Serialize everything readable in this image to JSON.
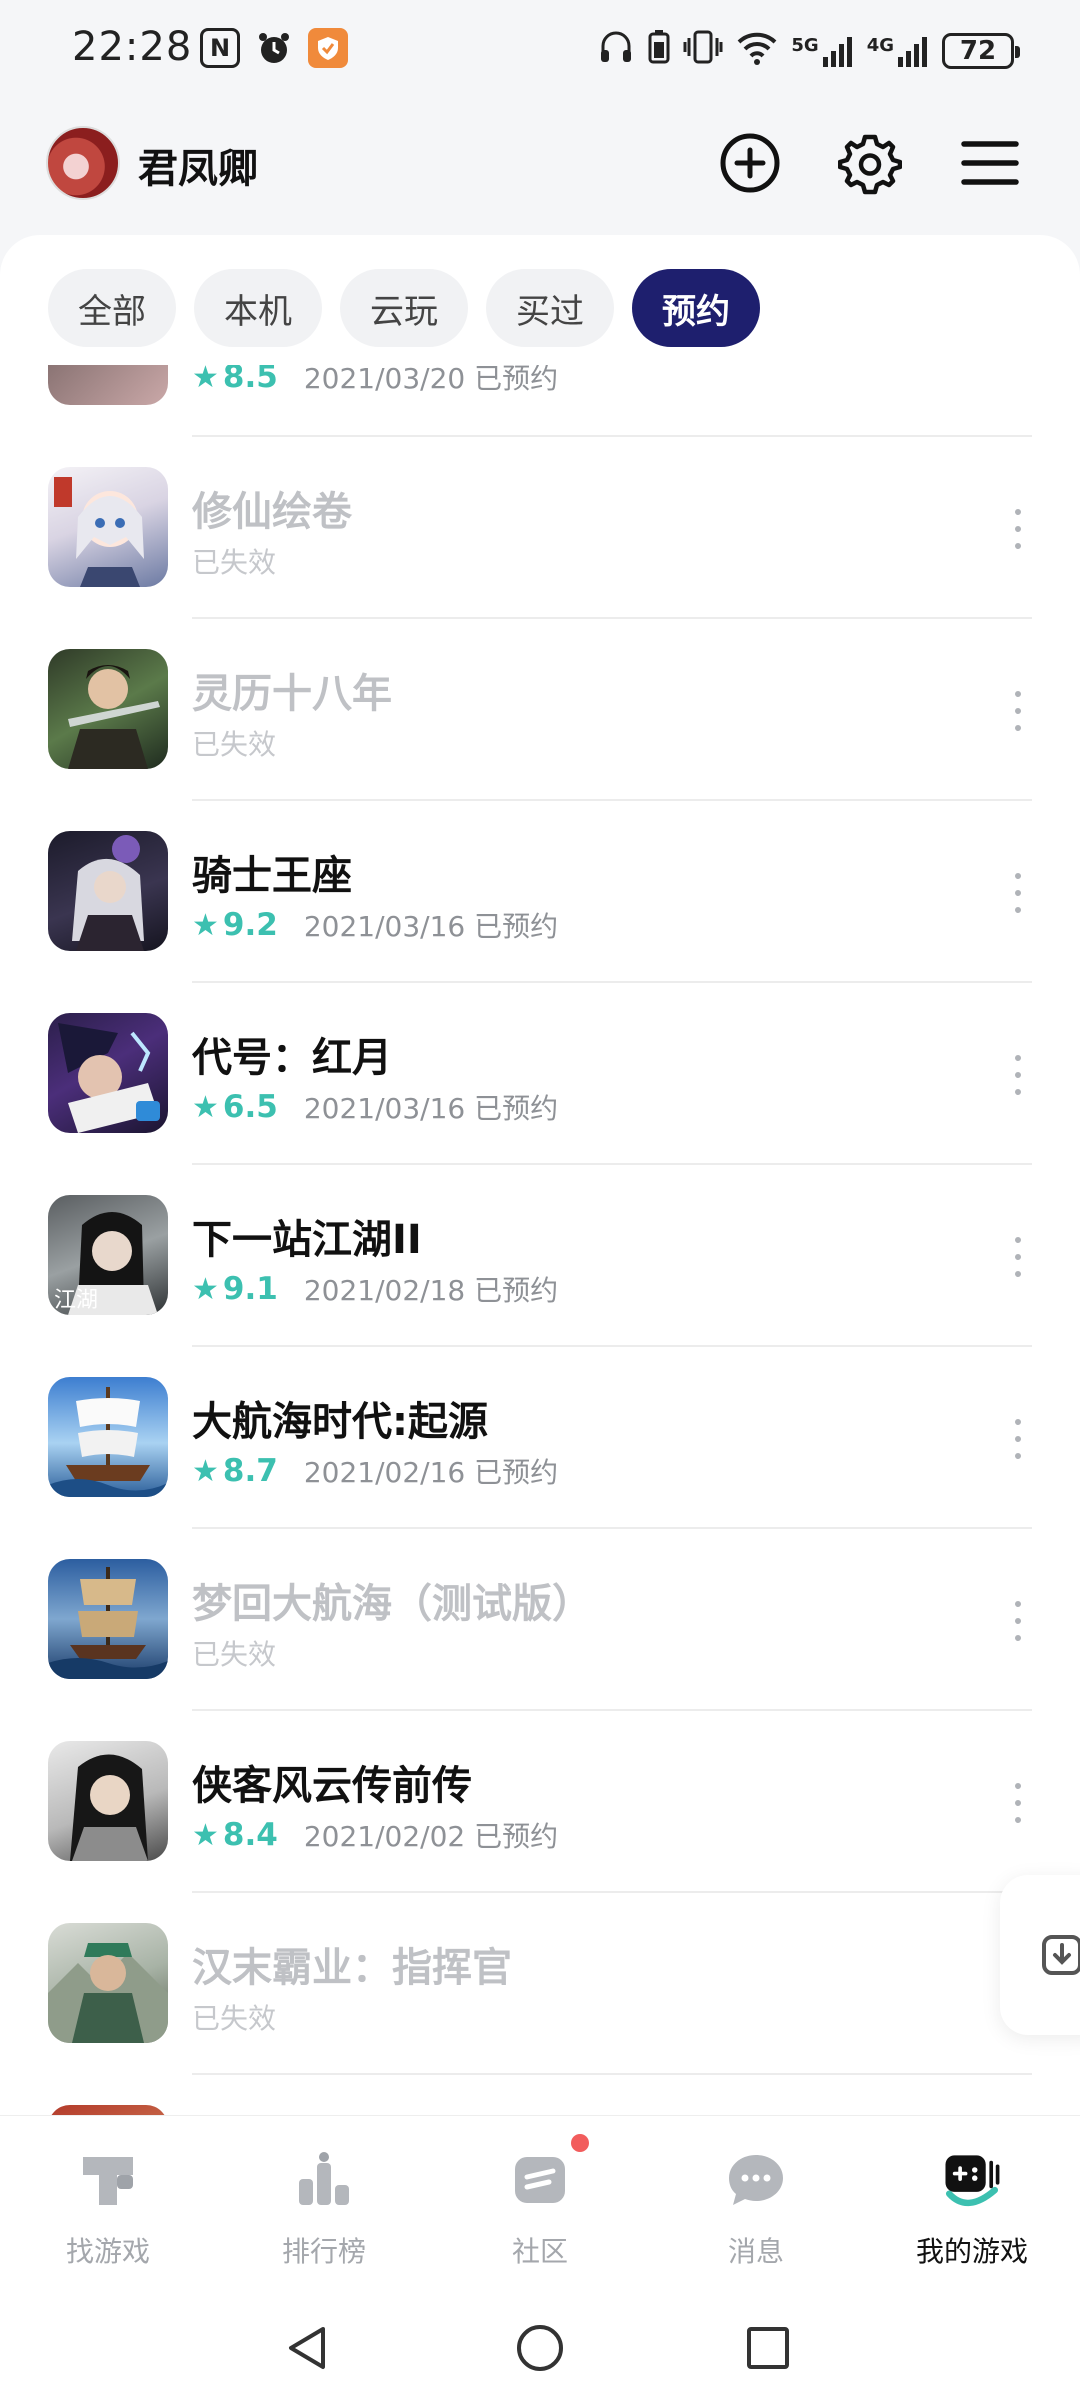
{
  "status_bar": {
    "time": "22:28",
    "battery": "72",
    "net1": "5G",
    "net2": "4G"
  },
  "header": {
    "username": "君凤卿"
  },
  "tabs": [
    {
      "label": "全部",
      "active": false
    },
    {
      "label": "本机",
      "active": false
    },
    {
      "label": "云玩",
      "active": false
    },
    {
      "label": "买过",
      "active": false
    },
    {
      "label": "预约",
      "active": true
    }
  ],
  "partial_top_row": {
    "score": "8.5",
    "meta": "2021/03/20 已预约"
  },
  "games": [
    {
      "name": "修仙绘卷",
      "status": "已失效",
      "expired": true,
      "icon": "xiuxian-icon"
    },
    {
      "name": "灵历十八年",
      "status": "已失效",
      "expired": true,
      "icon": "lingli-icon"
    },
    {
      "name": "骑士王座",
      "score": "9.2",
      "meta": "2021/03/16 已预约",
      "expired": false,
      "icon": "knight-throne-icon"
    },
    {
      "name": "代号：红月",
      "score": "6.5",
      "meta": "2021/03/16 已预约",
      "expired": false,
      "icon": "red-moon-icon"
    },
    {
      "name": "下一站江湖II",
      "score": "9.1",
      "meta": "2021/02/18 已预约",
      "expired": false,
      "icon": "jianghu-icon"
    },
    {
      "name": "大航海时代:起源",
      "score": "8.7",
      "meta": "2021/02/16 已预约",
      "expired": false,
      "icon": "sailing-ship-icon"
    },
    {
      "name": "梦回大航海（测试版）",
      "status": "已失效",
      "expired": true,
      "icon": "dream-sailing-icon"
    },
    {
      "name": "侠客风云传前传",
      "score": "8.4",
      "meta": "2021/02/02 已预约",
      "expired": false,
      "icon": "xiake-icon"
    },
    {
      "name": "汉末霸业：指挥官",
      "status": "已失效",
      "expired": true,
      "icon": "hanmo-icon"
    }
  ],
  "bottom_nav": [
    {
      "label": "找游戏",
      "icon": "find-games-icon"
    },
    {
      "label": "排行榜",
      "icon": "ranking-icon"
    },
    {
      "label": "社区",
      "icon": "community-icon"
    },
    {
      "label": "消息",
      "icon": "messages-icon"
    },
    {
      "label": "我的游戏",
      "icon": "my-games-icon",
      "active": true
    }
  ],
  "colors": {
    "accent": "#1e1f6e",
    "score": "#3cc0b0",
    "badge": "#f25d5d"
  }
}
